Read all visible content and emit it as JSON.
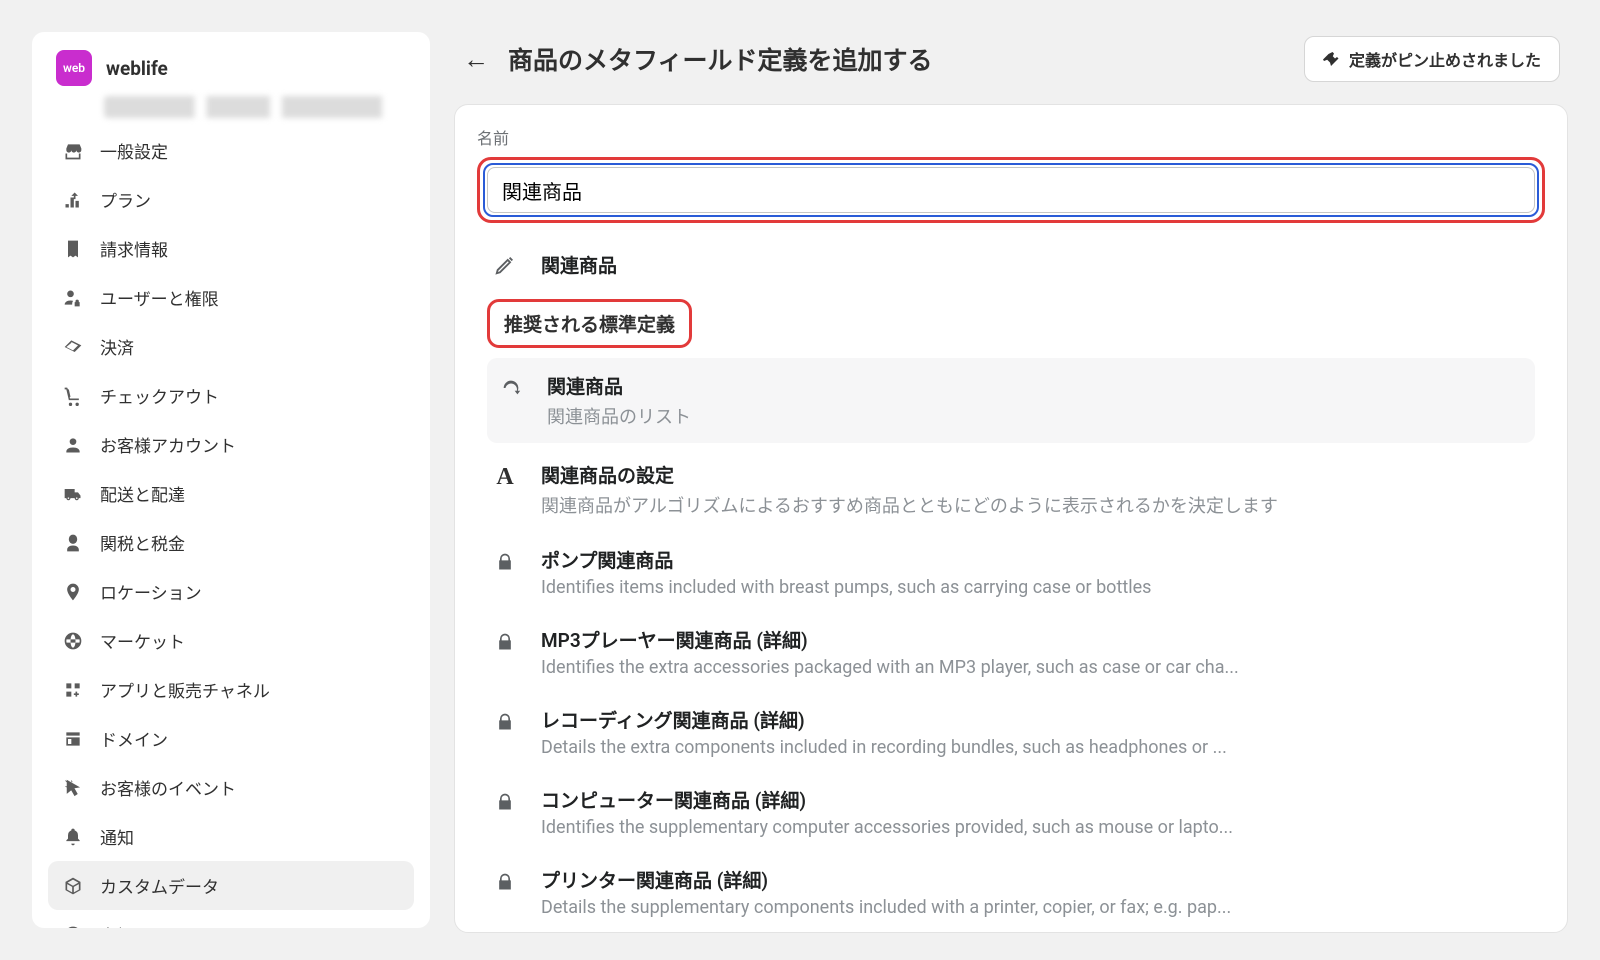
{
  "brand": {
    "badge": "web",
    "name": "weblife"
  },
  "sidebar": {
    "activeIndex": 13,
    "items": [
      {
        "label": "一般設定",
        "icon": "store"
      },
      {
        "label": "プラン",
        "icon": "plan"
      },
      {
        "label": "請求情報",
        "icon": "receipt"
      },
      {
        "label": "ユーザーと権限",
        "icon": "user-lock"
      },
      {
        "label": "決済",
        "icon": "payment"
      },
      {
        "label": "チェックアウト",
        "icon": "cart"
      },
      {
        "label": "お客様アカウント",
        "icon": "customer"
      },
      {
        "label": "配送と配達",
        "icon": "truck"
      },
      {
        "label": "関税と税金",
        "icon": "tax"
      },
      {
        "label": "ロケーション",
        "icon": "pin"
      },
      {
        "label": "マーケット",
        "icon": "globe"
      },
      {
        "label": "アプリと販売チャネル",
        "icon": "apps"
      },
      {
        "label": "ドメイン",
        "icon": "domain"
      },
      {
        "label": "お客様のイベント",
        "icon": "cursor"
      },
      {
        "label": "通知",
        "icon": "bell"
      },
      {
        "label": "カスタムデータ",
        "icon": "package"
      },
      {
        "label": "言語",
        "icon": "lang"
      }
    ]
  },
  "header": {
    "title": "商品のメタフィールド定義を追加する",
    "pin_label": "定義がピン止めされました"
  },
  "form": {
    "name_label": "名前",
    "name_value": "関連商品"
  },
  "dropdown": {
    "create_label": "関連商品",
    "section_header": "推奨される標準定義",
    "items": [
      {
        "title": "関連商品",
        "desc": "関連商品のリスト",
        "icon": "loop",
        "highlight": true
      },
      {
        "title": "関連商品の設定",
        "desc": "関連商品がアルゴリズムによるおすすめ商品とともにどのように表示されるかを決定します",
        "icon": "font"
      },
      {
        "title": "ポンプ関連商品",
        "desc": "Identifies items included with breast pumps, such as carrying case or bottles",
        "icon": "lock"
      },
      {
        "title": "MP3プレーヤー関連商品 (詳細)",
        "desc": "Identifies the extra accessories packaged with an MP3 player, such as case or car cha...",
        "icon": "lock"
      },
      {
        "title": "レコーディング関連商品 (詳細)",
        "desc": "Details the extra components included in recording bundles, such as headphones or ...",
        "icon": "lock"
      },
      {
        "title": "コンピューター関連商品 (詳細)",
        "desc": "Identifies the supplementary computer accessories provided, such as mouse or lapto...",
        "icon": "lock"
      },
      {
        "title": "プリンター関連商品 (詳細)",
        "desc": "Details the supplementary components included with a printer, copier, or fax; e.g. pap...",
        "icon": "lock"
      }
    ]
  }
}
